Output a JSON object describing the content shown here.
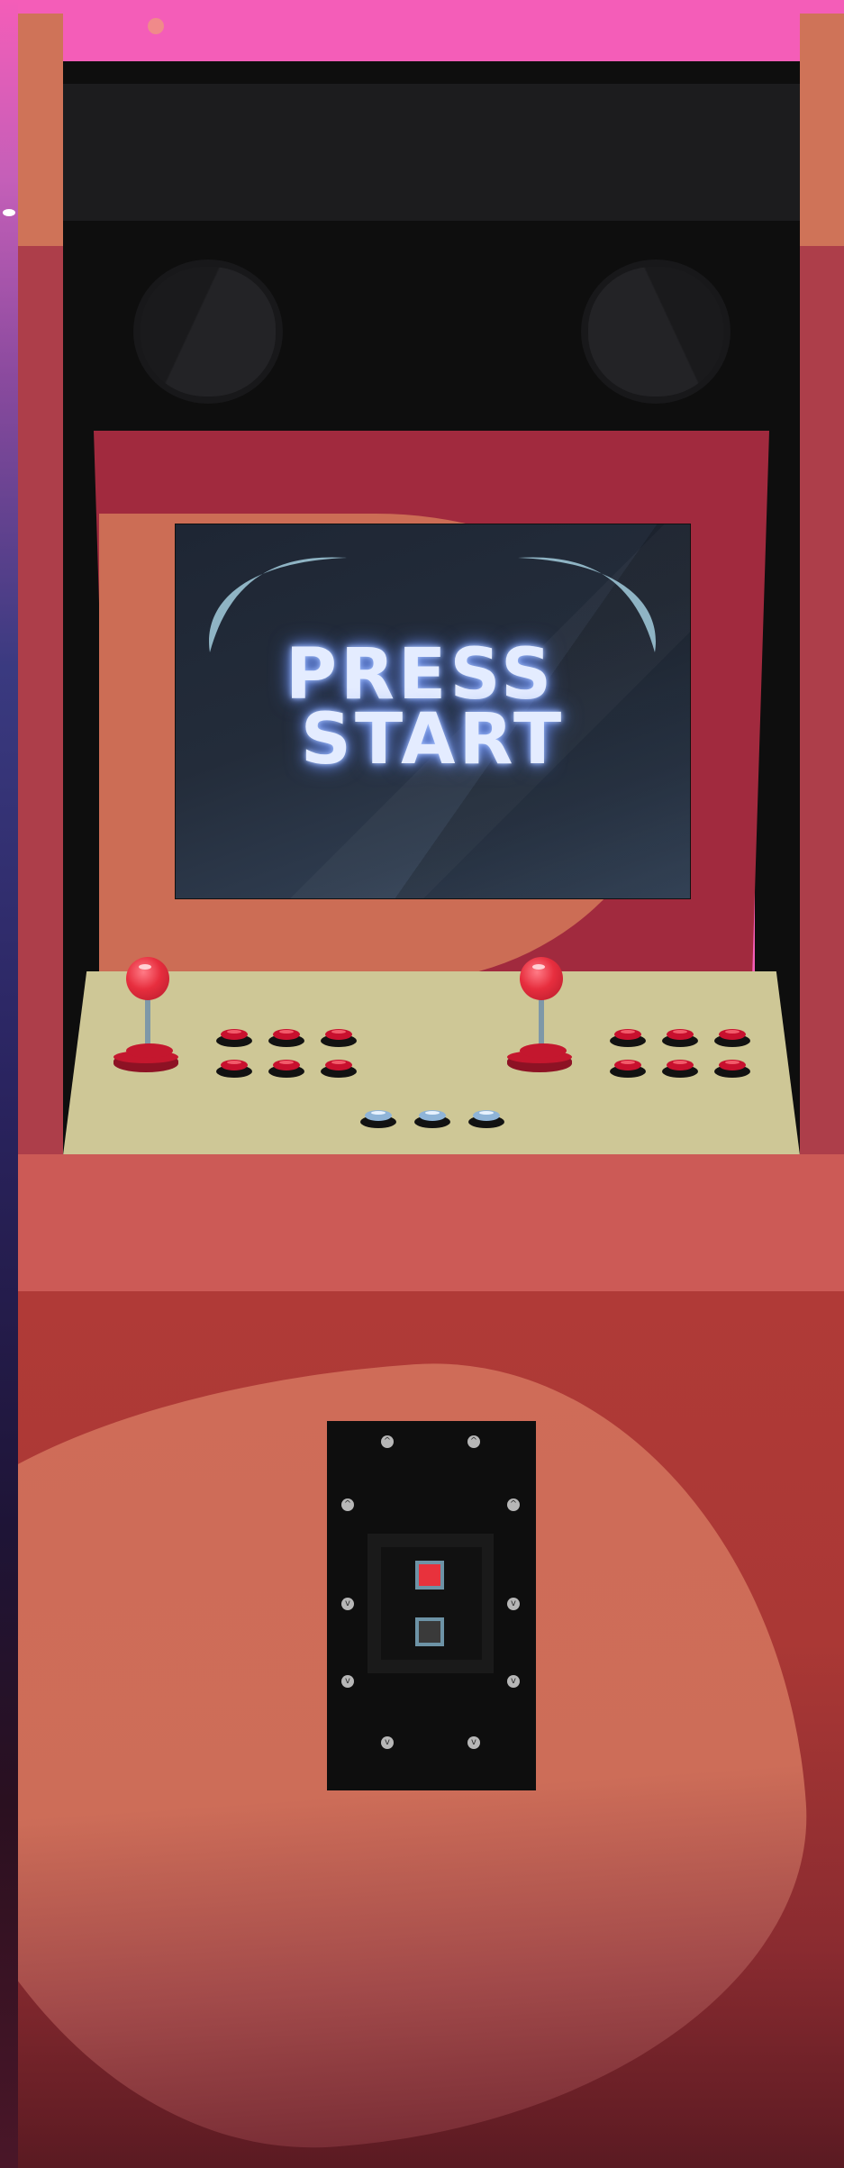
{
  "screen": {
    "line1": "PRESS",
    "line2": "START"
  },
  "colors": {
    "sky": "#f45db8",
    "cabinet_side": "#ad3e4a",
    "bezel": "#a12a3e",
    "control_panel": "#cec796",
    "joystick_ball": "#e72e3e",
    "action_button": "#c8102e",
    "start_button": "#8fb4d8",
    "screen_text_glow": "#a9c4ff",
    "coin_slot_active": "#e8323c",
    "coin_slot_inactive": "#3a3a3a"
  },
  "coin_door": {
    "slots": [
      {
        "state": "active"
      },
      {
        "state": "inactive"
      }
    ]
  }
}
